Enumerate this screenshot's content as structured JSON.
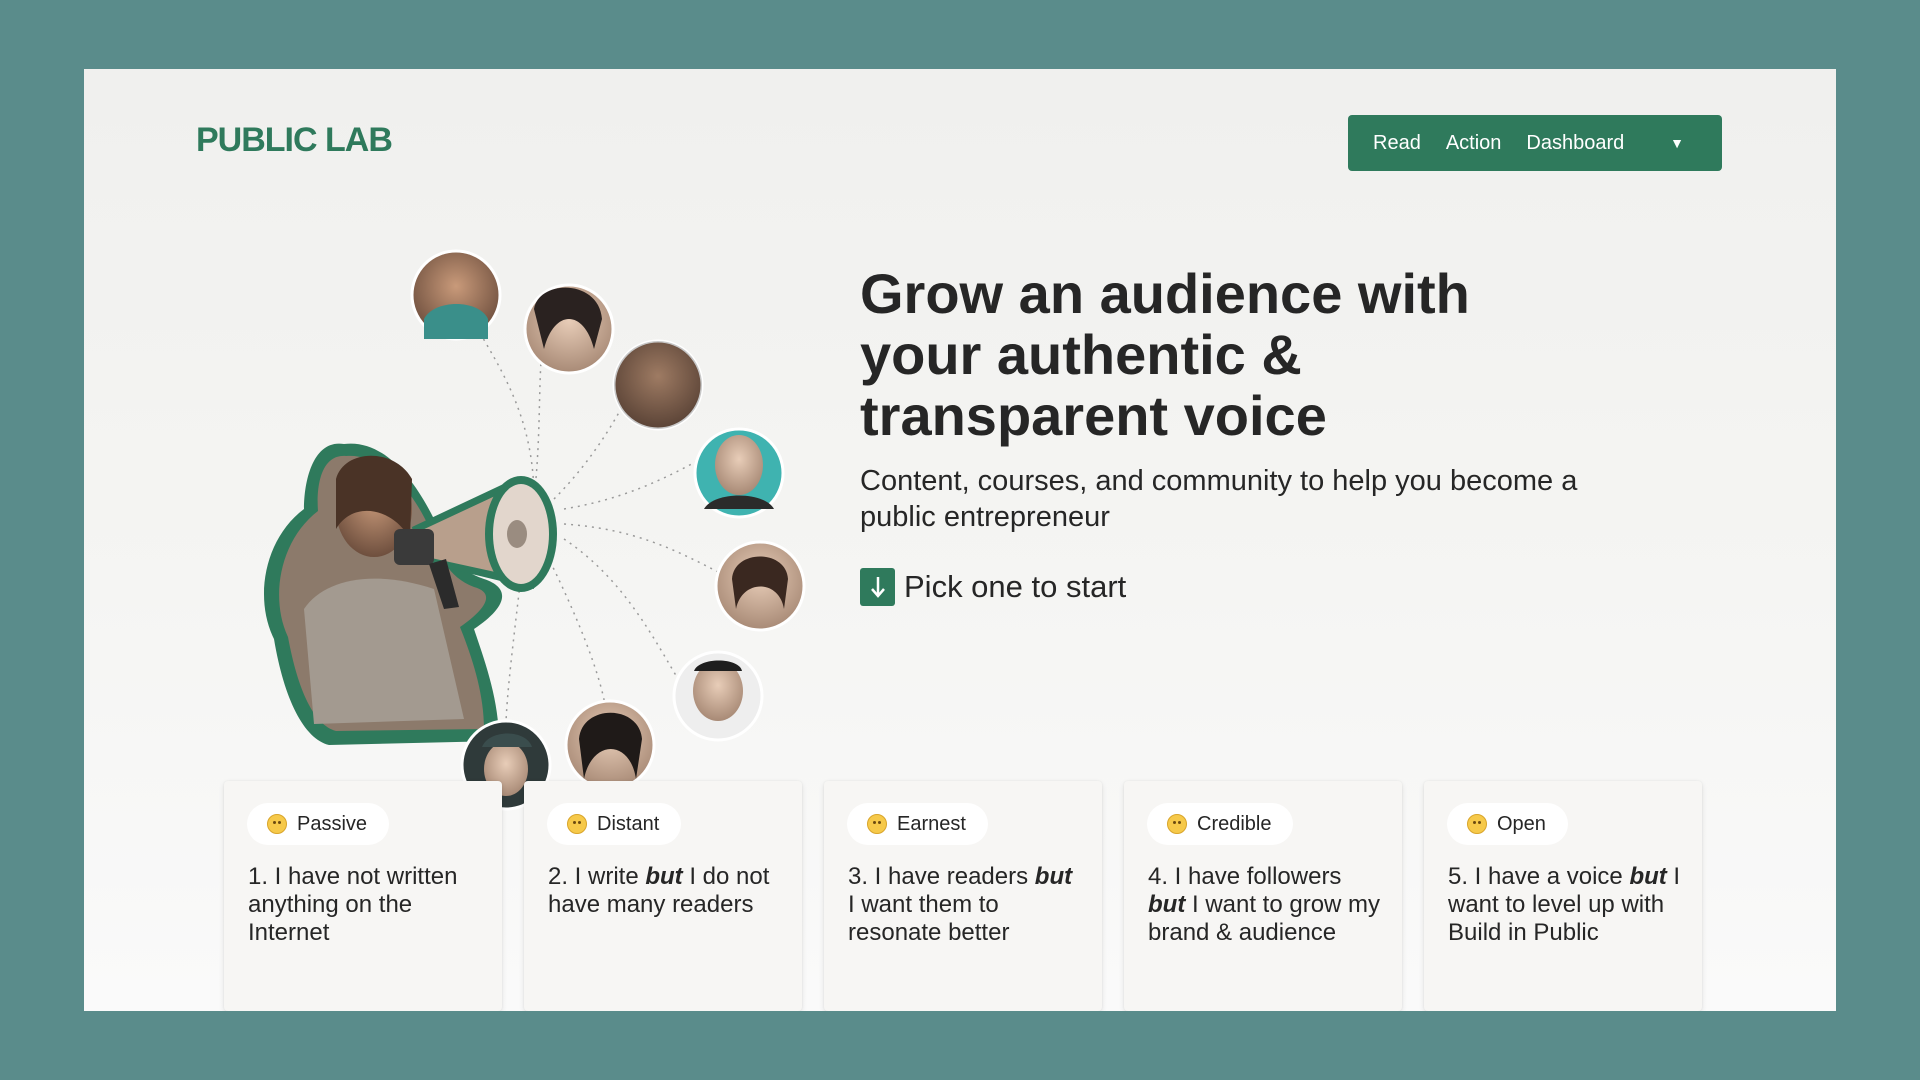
{
  "header": {
    "logo": "PUBLIC LAB",
    "nav": {
      "items": [
        "Read",
        "Action",
        "Dashboard"
      ],
      "dropdown_icon": "caret-down-icon"
    }
  },
  "hero": {
    "title": "Grow an audience with your authentic & transparent voice",
    "subtitle": "Content, courses, and community to help you become a public entrepreneur",
    "cta": {
      "label": "Pick one to start",
      "icon": "arrow-down-icon"
    }
  },
  "illustration": {
    "main": "woman-with-megaphone",
    "avatar_count": 9
  },
  "cards": [
    {
      "badge": "Passive",
      "emoji": "unamused-face",
      "parts": [
        {
          "text": "1. I have not written anything on the Internet",
          "bold": false
        }
      ]
    },
    {
      "badge": "Distant",
      "emoji": "tired-face",
      "parts": [
        {
          "text": "2. I write ",
          "bold": false
        },
        {
          "text": "but",
          "bold": true
        },
        {
          "text": " I do not have many readers",
          "bold": false
        }
      ]
    },
    {
      "badge": "Earnest",
      "emoji": "smiling-face",
      "parts": [
        {
          "text": "3. I have readers ",
          "bold": false
        },
        {
          "text": "but",
          "bold": true
        },
        {
          "text": " I want them to resonate better",
          "bold": false
        }
      ]
    },
    {
      "badge": "Credible",
      "emoji": "smiling-face-with-smiling-eyes",
      "parts": [
        {
          "text": "4. I have followers ",
          "bold": false
        },
        {
          "text": "but",
          "bold": true
        },
        {
          "text": " I want to grow my brand & audience",
          "bold": false
        }
      ]
    },
    {
      "badge": "Open",
      "emoji": "hugging-face",
      "parts": [
        {
          "text": "5. I have a voice ",
          "bold": false
        },
        {
          "text": "but",
          "bold": true
        },
        {
          "text": " I want to level up with Build in Public",
          "bold": false
        }
      ]
    }
  ],
  "colors": {
    "brand": "#2f7a5c",
    "frame": "#5a8c8b",
    "text": "#262626"
  }
}
